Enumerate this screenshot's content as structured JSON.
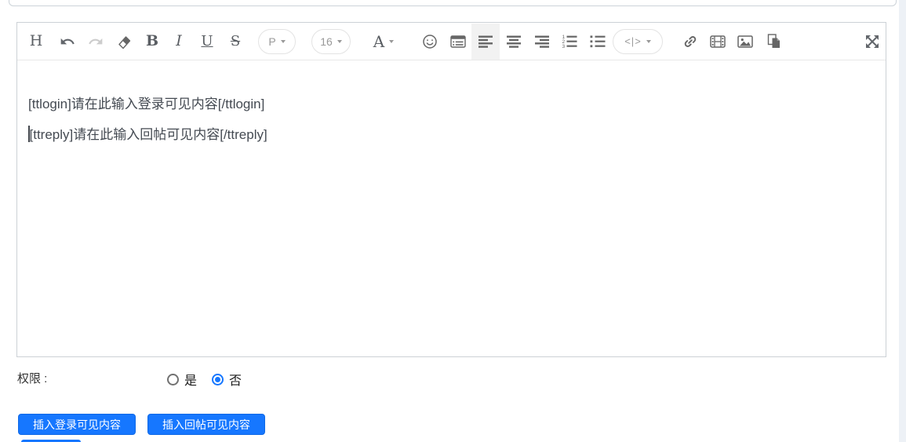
{
  "editor": {
    "toolbar": {
      "heading": "H",
      "bold": "B",
      "italic": "I",
      "underline": "U",
      "strikethrough": "S",
      "paragraph_select": "P",
      "font_size_select": "16",
      "font_color": "A",
      "code_select": "<|>"
    },
    "content": {
      "paragraphs": [
        "[ttlogin]请在此输入登录可见内容[/ttlogin]",
        "[ttreply]请在此输入回帖可见内容[/ttreply]"
      ]
    }
  },
  "permission": {
    "label": "权限 :",
    "options": [
      {
        "label": "是",
        "checked": false
      },
      {
        "label": "否",
        "checked": true
      }
    ]
  },
  "buttons": {
    "insert_login": "插入登录可见内容",
    "insert_reply": "插入回帖可见内容"
  },
  "icons": {
    "undo": "undo-arrow",
    "redo": "redo-arrow",
    "clear_format": "eraser",
    "emoji": "smiley-face",
    "panel": "list-panel",
    "align_left": "align-left-bars",
    "align_center": "align-center-bars",
    "align_right": "align-right-bars",
    "ordered_list": "numbered-list",
    "unordered_list": "bullet-list",
    "link": "chain-link",
    "video": "film-strip",
    "image": "picture-mountain",
    "paste": "paste-document",
    "fullscreen": "expand-arrows"
  },
  "colors": {
    "primary": "#1677ff",
    "toolbar_icon": "#666666",
    "toolbar_icon_disabled": "#cccccc",
    "active_item_bg": "#f2f2f2",
    "editor_text": "#444a52"
  }
}
